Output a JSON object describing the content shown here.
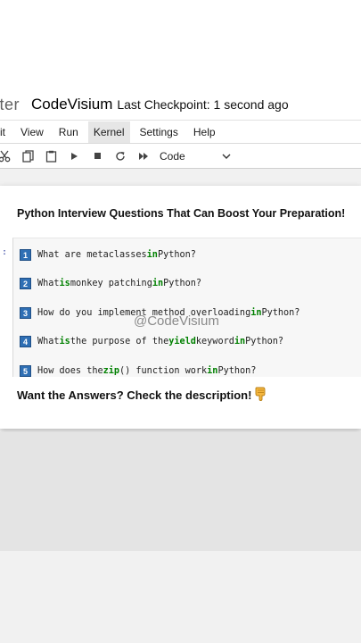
{
  "header": {
    "logo_text": "yter",
    "notebook_name": "CodeVisium",
    "checkpoint": "Last Checkpoint: 1 second ago"
  },
  "menu": {
    "items": [
      {
        "label": "it"
      },
      {
        "label": "View"
      },
      {
        "label": "Run"
      },
      {
        "label": "Kernel"
      },
      {
        "label": "Settings"
      },
      {
        "label": "Help"
      }
    ],
    "active": "Kernel"
  },
  "toolbar": {
    "icons": [
      "cut-icon",
      "copy-icon",
      "paste-icon",
      "run-icon",
      "stop-icon",
      "restart-icon",
      "fast-forward-icon"
    ],
    "cell_type": "Code"
  },
  "content": {
    "heading": "Python Interview Questions That Can Boost Your Preparation!",
    "prompt": ":",
    "questions": [
      {
        "num": "1",
        "pre": "What are metaclasses ",
        "kw1": "in",
        "mid": " Python?",
        "kw2": "",
        "mid2": "",
        "kw3": "",
        "post": ""
      },
      {
        "num": "2",
        "pre": "What ",
        "kw1": "is",
        "mid": " monkey patching ",
        "kw2": "in",
        "mid2": " Python?",
        "kw3": "",
        "post": ""
      },
      {
        "num": "3",
        "pre": "How do you implement method overloading ",
        "kw1": "in",
        "mid": " Python?",
        "kw2": "",
        "mid2": "",
        "kw3": "",
        "post": ""
      },
      {
        "num": "4",
        "pre": "What ",
        "kw1": "is",
        "mid": " the purpose of the ",
        "kw2": "yield",
        "mid2": " keyword ",
        "kw3": "in",
        "post": " Python?"
      },
      {
        "num": "5",
        "pre": "How does the ",
        "kw1": "zip",
        "mid": "() function work ",
        "kw2": "in",
        "mid2": " Python?",
        "kw3": "",
        "post": ""
      }
    ],
    "watermark": "@CodeVisium",
    "footer": "Want the Answers? Check the description!",
    "footer_icon": "pointing-down-hand-icon"
  },
  "colors": {
    "keyword": "#008000",
    "number_badge": "#2f6fb4",
    "prompt": "#303f9f"
  }
}
